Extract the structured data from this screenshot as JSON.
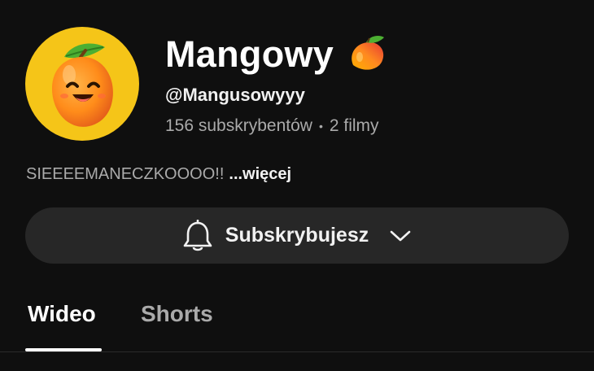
{
  "channel": {
    "name": "Mangowy",
    "handle": "@Mangusowyyy",
    "subscribers": "156 subskrybentów",
    "separator": "•",
    "videos": "2 filmy",
    "avatar_icon": "mango-mascot-avatar",
    "name_emoji_icon": "mango-icon"
  },
  "description": {
    "text": "SIEEEEMANECZKOOOO!!",
    "more_label": "...więcej"
  },
  "subscribe": {
    "label": "Subskrybujesz",
    "bell_icon": "bell-icon",
    "chevron_icon": "chevron-down-icon"
  },
  "tabs": [
    {
      "label": "Wideo",
      "active": true
    },
    {
      "label": "Shorts",
      "active": false
    }
  ],
  "colors": {
    "background": "#0f0f0f",
    "avatar_bg": "#f5c518",
    "button_bg": "#272727",
    "secondary_text": "#aaaaaa",
    "primary_text": "#f1f1f1"
  }
}
